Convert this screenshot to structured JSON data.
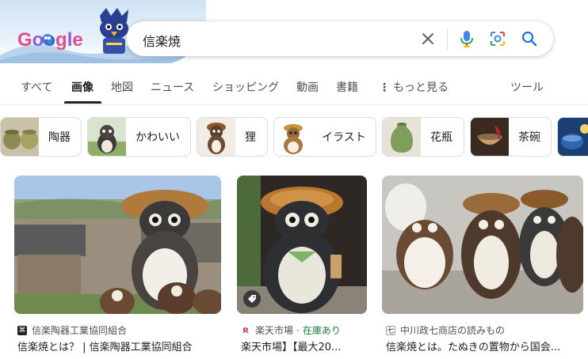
{
  "doodle": {
    "logo_text": "Google"
  },
  "search": {
    "query": "信楽焼"
  },
  "tabs": [
    {
      "label": "すべて"
    },
    {
      "label": "画像"
    },
    {
      "label": "地図"
    },
    {
      "label": "ニュース"
    },
    {
      "label": "ショッピング"
    },
    {
      "label": "動画"
    },
    {
      "label": "書籍"
    },
    {
      "label": "もっと見る"
    }
  ],
  "tools_label": "ツール",
  "chips": [
    {
      "label": "陶器"
    },
    {
      "label": "かわいい"
    },
    {
      "label": "狸"
    },
    {
      "label": "イラスト"
    },
    {
      "label": "花瓶"
    },
    {
      "label": "茶碗"
    }
  ],
  "results": [
    {
      "source": "信楽陶器工業協同組合",
      "title": "信楽焼とは？ | 信楽陶器工業協同組合"
    },
    {
      "source": "楽天市場",
      "stock": "在庫あり",
      "title": "楽天市場】【最大20..."
    },
    {
      "source": "中川政七商店の読みもの",
      "title": "信楽焼とは。たぬきの置物から国会..."
    }
  ],
  "colors": {
    "accent": "#1a73e8",
    "text_primary": "#202124",
    "text_secondary": "#4d5156",
    "in_stock": "#188038",
    "chip_border": "#dadce0"
  }
}
